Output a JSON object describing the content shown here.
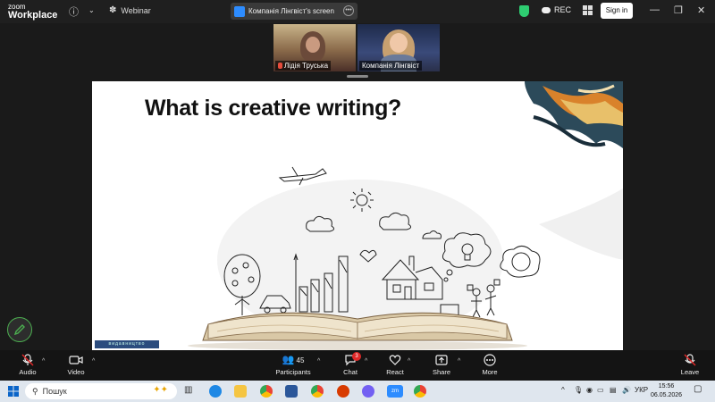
{
  "titlebar": {
    "logo_line1": "zoom",
    "logo_line2": "Workplace",
    "webinar_label": "Webinar",
    "share_tab_label": "Компанія Лінгвіст's screen",
    "rec_label": "REC",
    "sign_in_label": "Sign in",
    "minimize": "—",
    "maximize": "❐",
    "close": "✕"
  },
  "participants_video": [
    {
      "name": "Лідія Труська",
      "muted": true
    },
    {
      "name": "Компанія Лінгвіст",
      "muted": false
    }
  ],
  "slide": {
    "title": "What is creative writing?",
    "publisher_strip": "видавництво"
  },
  "toolbar": {
    "audio": "Audio",
    "video": "Video",
    "participants": "Participants",
    "participants_count": "45",
    "chat": "Chat",
    "chat_badge": "3",
    "react": "React",
    "share": "Share",
    "more": "More",
    "leave": "Leave"
  },
  "taskbar": {
    "search_placeholder": "Пошук",
    "language": "УКР",
    "time": "15:56",
    "date": "06.05.2026"
  },
  "colors": {
    "accent_green": "#2ecc71",
    "zoom_blue": "#2d8cff",
    "alert_red": "#e02828"
  }
}
